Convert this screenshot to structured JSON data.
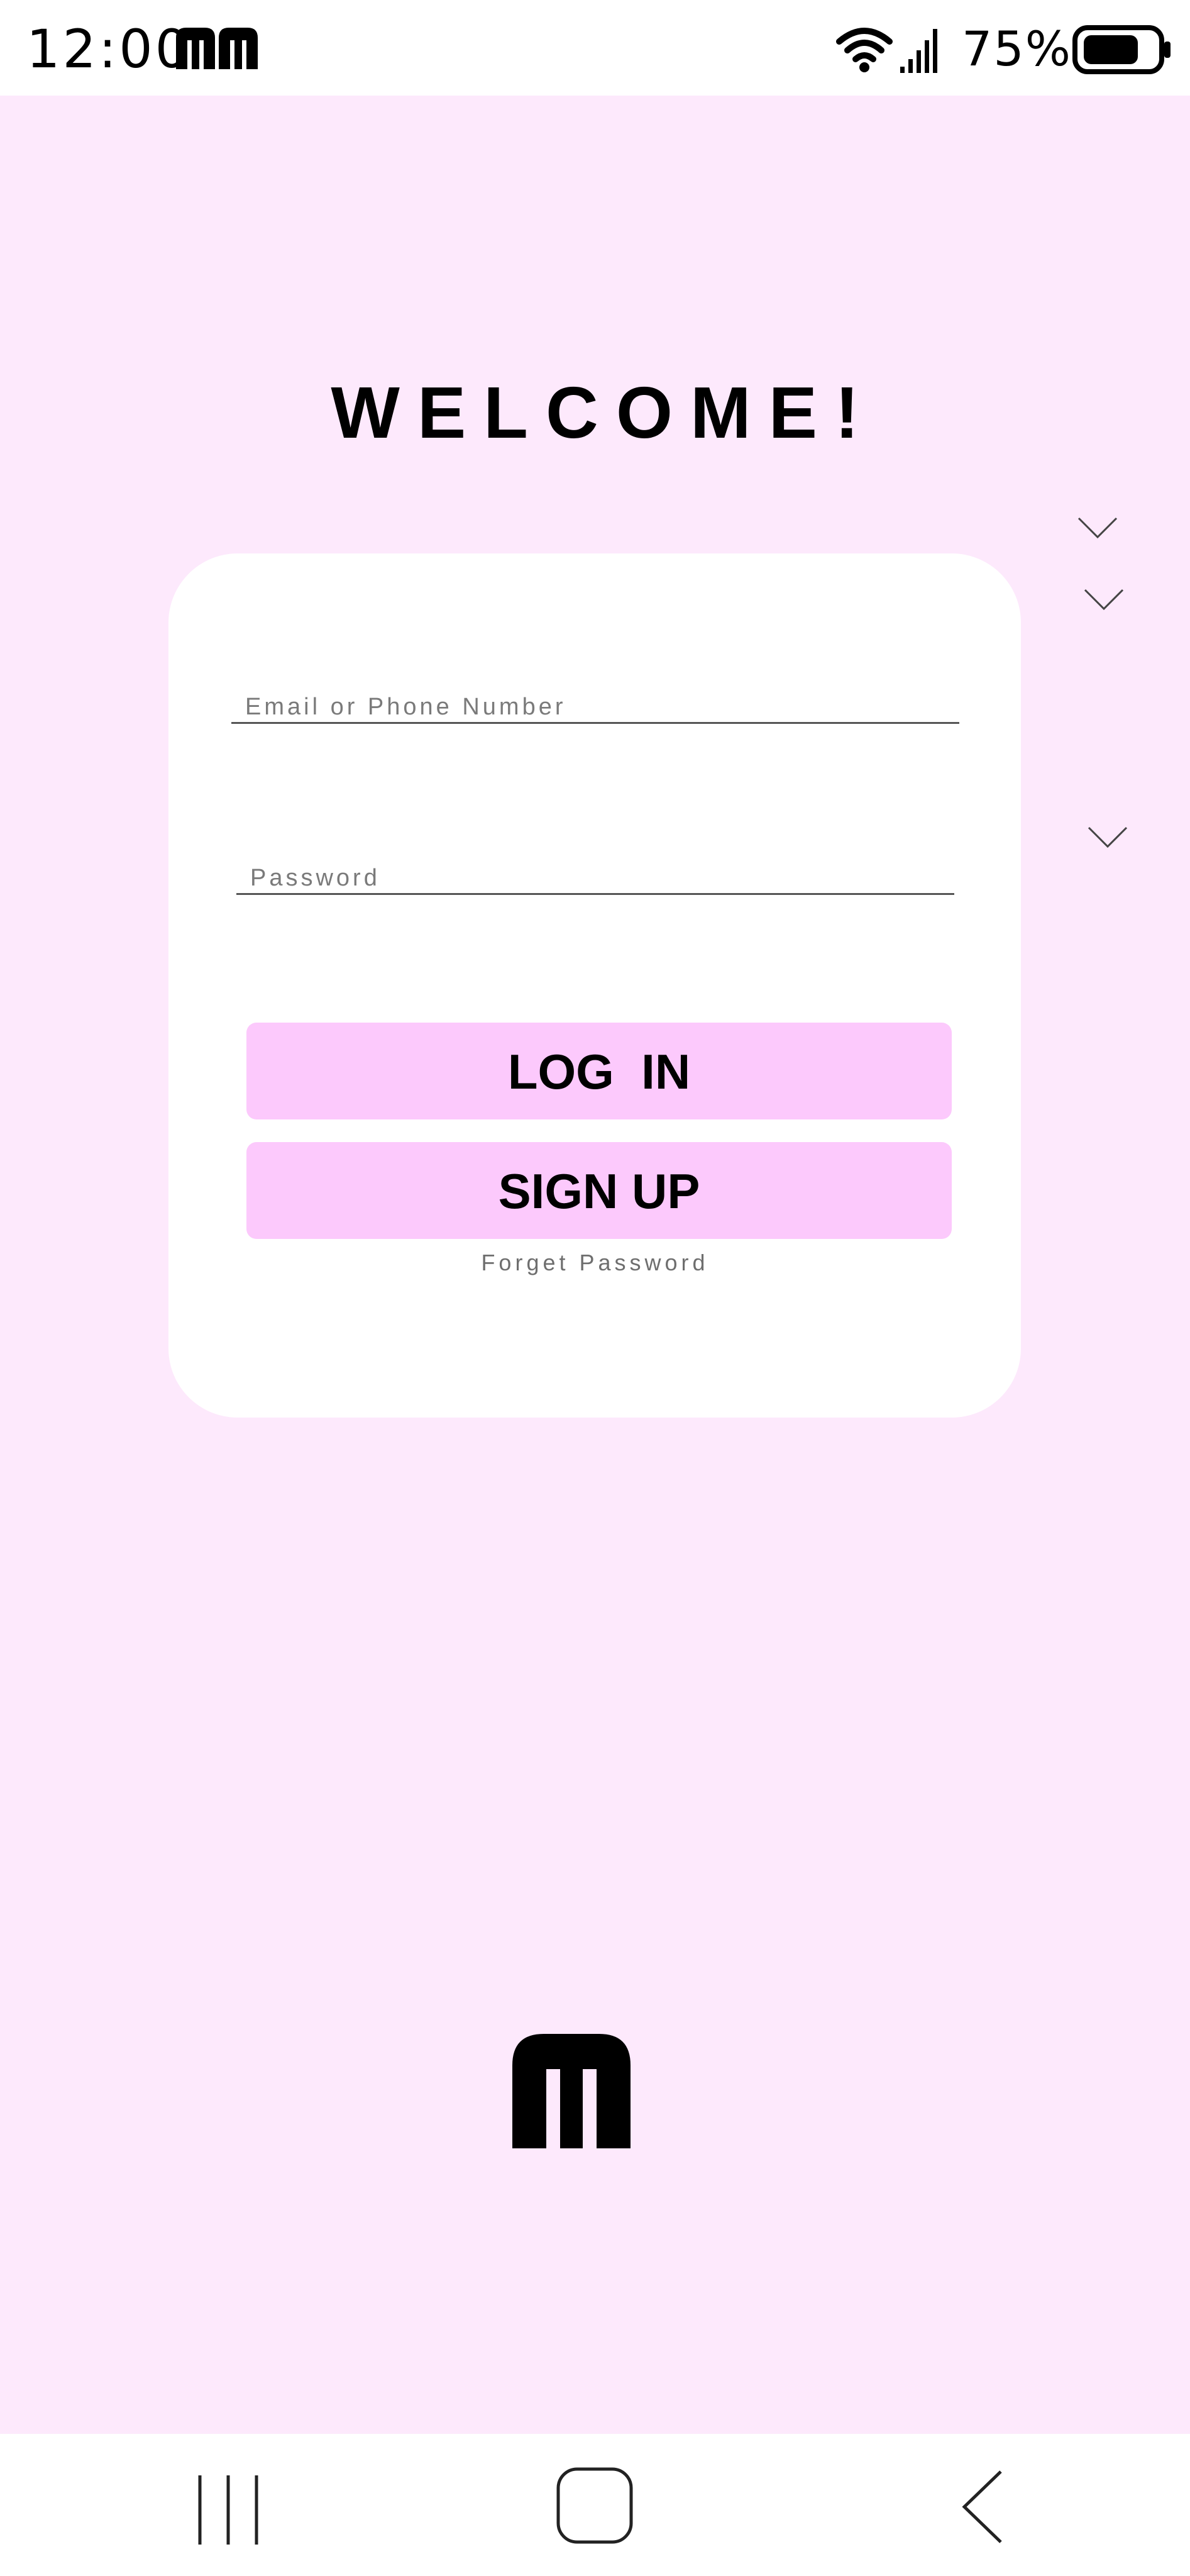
{
  "status_bar": {
    "time": "12:00",
    "battery_percent": "75%",
    "battery_level": 0.75,
    "icons": [
      "m-logo-icon",
      "m-logo-icon",
      "wifi-icon",
      "signal-icon",
      "battery-icon"
    ]
  },
  "login": {
    "title": "WELCOME!",
    "email_placeholder": "Email or Phone Number",
    "email_value": "",
    "password_placeholder": "Password",
    "password_value": "",
    "login_label": "LOG  IN",
    "signup_label": "SIGN UP",
    "forget_label": "Forget Password"
  },
  "chevrons": [
    "chevron-down-icon",
    "chevron-down-icon",
    "chevron-down-icon"
  ],
  "brand": {
    "logo_icon": "m-logo-icon"
  },
  "nav_bar": {
    "icons": [
      "recent-apps-icon",
      "home-icon",
      "back-icon"
    ]
  },
  "colors": {
    "background": "#fde9fc",
    "card": "#ffffff",
    "button": "#fcc9fc",
    "text": "#000000"
  }
}
